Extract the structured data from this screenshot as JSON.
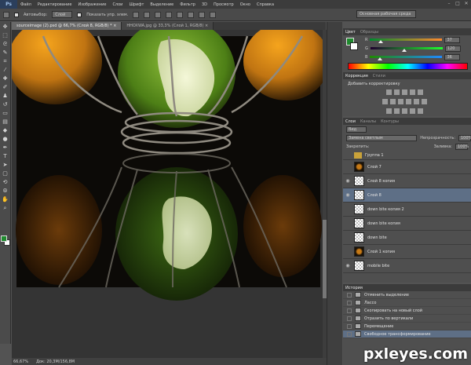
{
  "app": {
    "logo": "Ps"
  },
  "menu": [
    "Файл",
    "Редактирование",
    "Изображение",
    "Слои",
    "Шрифт",
    "Выделение",
    "Фильтр",
    "3D",
    "Просмотр",
    "Окно",
    "Справка"
  ],
  "window_controls": [
    "–",
    "□",
    "✕"
  ],
  "options": {
    "autoselect_label": "Автовыбор:",
    "autoselect_value": "Слой",
    "show_controls_label": "Показать упр. элем.",
    "workspace": "Основная рабочая среда"
  },
  "tabs": [
    {
      "label": "sourceimage (2).psd @ 66,7% (Слой 8, RGB/8) *  ×",
      "active": true
    },
    {
      "label": "HHOXWA.jpg @ 33,3% (Слой 1, RGB/8)  ×",
      "active": false
    }
  ],
  "status": {
    "zoom": "66,67%",
    "doc": "Док: 20,3M/156,8M"
  },
  "color_panel": {
    "tabs": [
      "Цвет",
      "Образцы"
    ],
    "fg_color": "#1f8a2e",
    "sliders": [
      {
        "label": "R",
        "value": "37",
        "gradient": "linear-gradient(90deg,#008a2e,#ff8a2e)",
        "thumb": 0.15
      },
      {
        "label": "G",
        "value": "120",
        "gradient": "linear-gradient(90deg,#1f002e,#1fff2e)",
        "thumb": 0.47
      },
      {
        "label": "B",
        "value": "36",
        "gradient": "linear-gradient(90deg,#1f8a00,#1f8aff)",
        "thumb": 0.14
      }
    ]
  },
  "adjustments_panel": {
    "tabs": [
      "Коррекция",
      "Стили"
    ],
    "subtitle": "Добавить корректировку"
  },
  "layers_panel": {
    "tabs": [
      "Слои",
      "Каналы",
      "Контуры"
    ],
    "kind_filter": "Вид",
    "blend_mode": "Замена светлым",
    "opacity_label": "Непрозрачность:",
    "opacity_value": "100%",
    "lock_label": "Закрепить:",
    "fill_label": "Заливка:",
    "fill_value": "100%",
    "layers": [
      {
        "name": "Группа 1",
        "kind": "group",
        "visible": false
      },
      {
        "name": "Слой 7",
        "kind": "image",
        "visible": false
      },
      {
        "name": "Слой 8 копия",
        "kind": "empty",
        "visible": true
      },
      {
        "name": "Слой 8",
        "kind": "empty",
        "visible": true,
        "selected": true
      },
      {
        "name": "down bite копия 2",
        "kind": "empty",
        "visible": false
      },
      {
        "name": "down bite копия",
        "kind": "empty",
        "visible": false
      },
      {
        "name": "down bite",
        "kind": "empty",
        "visible": false
      },
      {
        "name": "Слой 1 копия",
        "kind": "image",
        "visible": false
      },
      {
        "name": "mobile bite",
        "kind": "empty",
        "visible": true
      }
    ]
  },
  "history_panel": {
    "title": "История",
    "items": [
      {
        "name": "Отменить выделение"
      },
      {
        "name": "Лассо"
      },
      {
        "name": "Скопировать на новый слой"
      },
      {
        "name": "Отразить по вертикали"
      },
      {
        "name": "Перемещение"
      },
      {
        "name": "Свободное трансформирование",
        "selected": true
      }
    ]
  },
  "watermark": "pxleyes.com"
}
